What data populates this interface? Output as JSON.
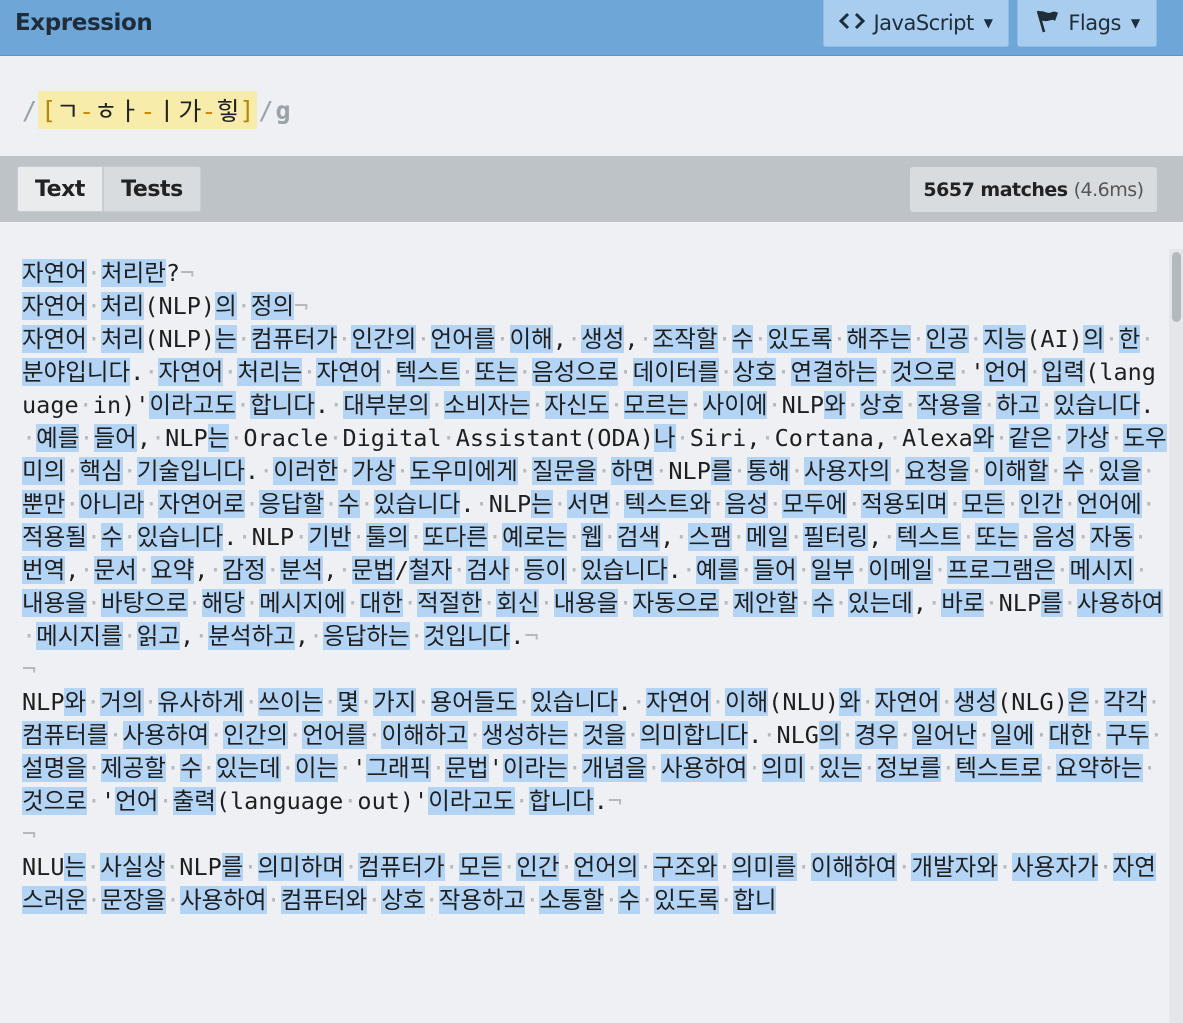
{
  "header": {
    "title": "Expression",
    "language_label": "JavaScript",
    "flags_label": "Flags",
    "icons": [
      "code-icon",
      "flag-icon",
      "caret-down-icon"
    ]
  },
  "expression": {
    "open_delim": "/",
    "set_open": "[",
    "set_parts": [
      {
        "kind": "char",
        "text": "ㄱ"
      },
      {
        "kind": "range",
        "text": "-"
      },
      {
        "kind": "char",
        "text": "ㅎ"
      },
      {
        "kind": "char",
        "text": "ㅏ"
      },
      {
        "kind": "range",
        "text": "-"
      },
      {
        "kind": "char",
        "text": "ㅣ"
      },
      {
        "kind": "char",
        "text": "가"
      },
      {
        "kind": "range",
        "text": "-"
      },
      {
        "kind": "char",
        "text": "힣"
      }
    ],
    "set_close": "]",
    "close_delim": "/",
    "flags": "g"
  },
  "tabs": {
    "text_label": "Text",
    "tests_label": "Tests"
  },
  "results": {
    "match_count": "5657 matches",
    "time": "(4.6ms)"
  },
  "text": {
    "paragraphs": [
      "자연어 처리란?",
      "자연어 처리(NLP)의 정의",
      "자연어 처리(NLP)는 컴퓨터가 인간의 언어를 이해, 생성, 조작할 수 있도록 해주는 인공 지능(AI)의 한 분야입니다. 자연어 처리는 자연어 텍스트 또는 음성으로 데이터를 상호 연결하는 것으로 '언어 입력(language in)'이라고도 합니다. 대부분의 소비자는 자신도 모르는 사이에 NLP와 상호 작용을 하고 있습니다. 예를 들어, NLP는 Oracle Digital Assistant(ODA)나 Siri, Cortana, Alexa와 같은 가상 도우미의 핵심 기술입니다. 이러한 가상 도우미에게 질문을 하면 NLP를 통해 사용자의 요청을 이해할 수 있을 뿐만 아니라 자연어로 응답할 수 있습니다. NLP는 서면 텍스트와 음성 모두에 적용되며 모든 인간 언어에 적용될 수 있습니다. NLP 기반 툴의 또다른 예로는 웹 검색, 스팸 메일 필터링, 텍스트 또는 음성 자동 번역, 문서 요약, 감정 분석, 문법/철자 검사 등이 있습니다. 예를 들어 일부 이메일 프로그램은 메시지 내용을 바탕으로 해당 메시지에 대한 적절한 회신 내용을 자동으로 제안할 수 있는데, 바로 NLP를 사용하여 메시지를 읽고, 분석하고, 응답하는 것입니다.",
      "",
      "NLP와 거의 유사하게 쓰이는 몇 가지 용어들도 있습니다. 자연어 이해(NLU)와 자연어 생성(NLG)은 각각 컴퓨터를 사용하여 인간의 언어를 이해하고 생성하는 것을 의미합니다. NLG의 경우 일어난 일에 대한 구두 설명을 제공할 수 있는데 이는 '그래픽 문법'이라는 개념을 사용하여 의미 있는 정보를 텍스트로 요약하는 것으로 '언어 출력(language out)'이라고도 합니다.",
      "",
      "NLU는 사실상 NLP를 의미하며 컴퓨터가 모든 인간 언어의 구조와 의미를 이해하여 개발자와 사용자가 자연스러운 문장을 사용하여 컴퓨터와 상호 작용하고 소통할 수 있도록 합니"
    ]
  }
}
